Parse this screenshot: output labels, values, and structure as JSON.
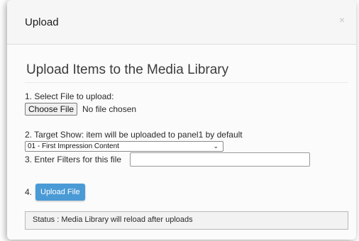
{
  "modal": {
    "title": "Upload",
    "close_glyph": "×"
  },
  "section": {
    "heading": "Upload Items to the Media Library"
  },
  "step1": {
    "label": "1. Select File to upload:",
    "choose_button": "Choose File",
    "file_status": "No file chosen"
  },
  "step2": {
    "label": "2. Target Show: item will be uploaded to panel1 by default",
    "selected_option": "01 - First Impression Content"
  },
  "step3": {
    "label": "3. Enter Filters for this file",
    "value": ""
  },
  "step4": {
    "label": "4.",
    "upload_button": "Upload File"
  },
  "status": {
    "text": "Status : Media Library will reload after uploads"
  },
  "colors": {
    "upload_button_bg": "#4a9ad6",
    "header_bg": "#f6f6f6"
  }
}
